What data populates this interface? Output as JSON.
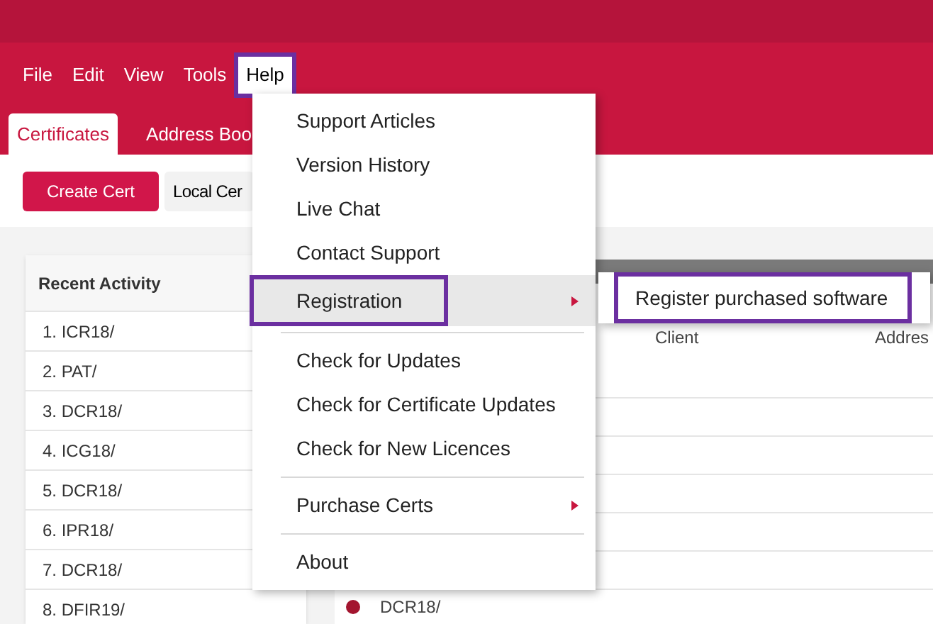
{
  "menu_bar": [
    {
      "label": "File",
      "open": false,
      "highlighted": false
    },
    {
      "label": "Edit",
      "open": false,
      "highlighted": false
    },
    {
      "label": "View",
      "open": false,
      "highlighted": false
    },
    {
      "label": "Tools",
      "open": false,
      "highlighted": false
    },
    {
      "label": "Help",
      "open": true,
      "highlighted": true
    }
  ],
  "tabs": [
    {
      "label": "Certificates",
      "selected": true
    },
    {
      "label": "Address Boo",
      "selected": false
    }
  ],
  "toolbar": [
    {
      "label": "Create Cert",
      "kind": "primary"
    },
    {
      "label": "Local Cer",
      "kind": "secondary"
    }
  ],
  "recent_activity": {
    "title": "Recent Activity",
    "items": [
      "1. ICR18/",
      "2. PAT/",
      "3. DCR18/",
      "4. ICG18/",
      "5. DCR18/",
      "6. IPR18/",
      "7. DCR18/",
      "8. DFIR19/"
    ]
  },
  "table": {
    "columns": [
      "Client",
      "Addres"
    ],
    "rows": [
      {
        "column_1": "DCR18/",
        "color": "#a3152f"
      }
    ]
  },
  "help_menu": [
    {
      "kind": "item",
      "label": "Support Articles",
      "submenu": false,
      "selected": false,
      "highlighted": false
    },
    {
      "kind": "item",
      "label": "Version History",
      "submenu": false,
      "selected": false,
      "highlighted": false
    },
    {
      "kind": "item",
      "label": "Live Chat",
      "submenu": false,
      "selected": false,
      "highlighted": false
    },
    {
      "kind": "item",
      "label": "Contact Support",
      "submenu": false,
      "selected": false,
      "highlighted": false
    },
    {
      "kind": "item",
      "label": "Registration",
      "submenu": true,
      "selected": true,
      "highlighted": true
    },
    {
      "kind": "separator"
    },
    {
      "kind": "item",
      "label": "Check for Updates",
      "submenu": false,
      "selected": false,
      "highlighted": false
    },
    {
      "kind": "item",
      "label": "Check for Certificate Updates",
      "submenu": false,
      "selected": false,
      "highlighted": false
    },
    {
      "kind": "item",
      "label": "Check for New Licences",
      "submenu": false,
      "selected": false,
      "highlighted": false
    },
    {
      "kind": "separator"
    },
    {
      "kind": "item",
      "label": "Purchase Certs",
      "submenu": true,
      "selected": false,
      "highlighted": false
    },
    {
      "kind": "separator"
    },
    {
      "kind": "item",
      "label": "About",
      "submenu": false,
      "selected": false,
      "highlighted": false
    }
  ],
  "submenu": [
    {
      "label": "Register purchased software",
      "highlighted": true
    }
  ]
}
